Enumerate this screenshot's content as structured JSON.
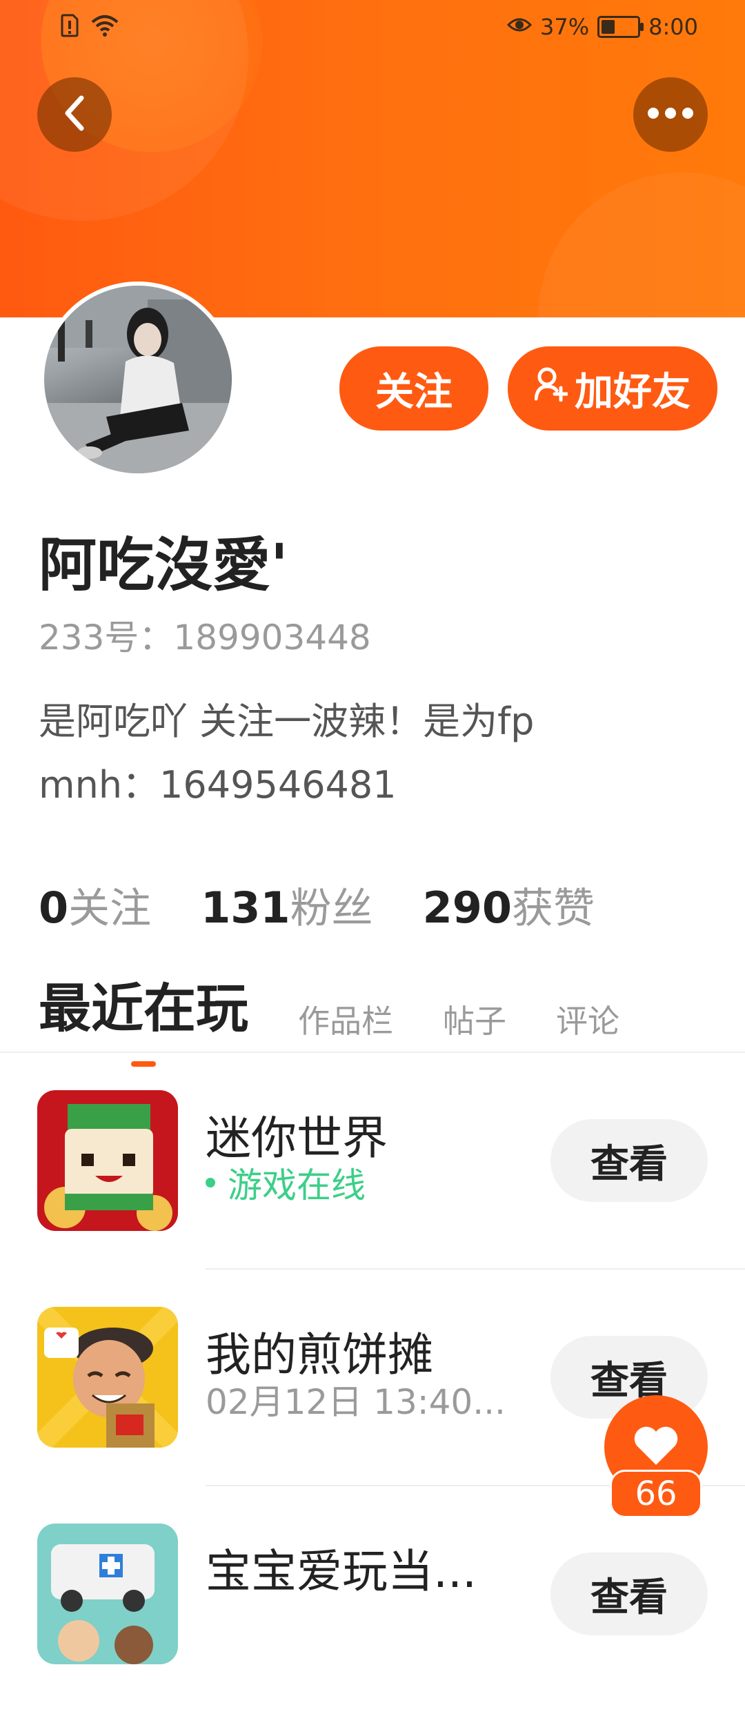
{
  "status_bar": {
    "battery_percent": "37%",
    "time": "8:00",
    "battery_level": 0.37
  },
  "profile": {
    "follow_label": "关注",
    "add_friend_label": "加好友",
    "name": "阿吃沒愛'",
    "id_text": "233号：189903448",
    "bio_line1": "是阿吃吖 关注一波辣！是为fp",
    "bio_line2": "mnh：1649546481"
  },
  "stats": [
    {
      "num": "0",
      "label": "关注"
    },
    {
      "num": "131",
      "label": "粉丝"
    },
    {
      "num": "290",
      "label": "获赞"
    }
  ],
  "tabs": [
    {
      "label": "最近在玩"
    },
    {
      "label": "作品栏"
    },
    {
      "label": "帖子"
    },
    {
      "label": "评论"
    }
  ],
  "games": [
    {
      "title": "迷你世界",
      "sub": "游戏在线",
      "button": "查看"
    },
    {
      "title": "我的煎饼摊",
      "sub": "02月12日 13:40...",
      "button": "查看"
    },
    {
      "title": "宝宝爱玩当...",
      "sub": "",
      "button": "查看"
    }
  ],
  "like_count": "66",
  "colors": {
    "accent": "#ff5a12",
    "online": "#3ccf88",
    "muted": "#9a9a9a"
  },
  "icons": {
    "back": "chevron-left-icon",
    "more": "more-dots-icon",
    "add_friend": "add-user-icon",
    "like": "heart-icon",
    "sim": "sim-alert-icon",
    "wifi": "wifi-icon",
    "eye": "eye-icon",
    "battery": "battery-icon"
  }
}
